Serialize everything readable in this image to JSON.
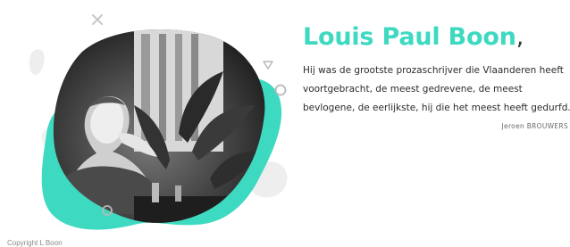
{
  "hero": {
    "title": "Louis Paul Boon",
    "title_punctuation": ",",
    "quote": "Hij was de grootste prozaschrijver die Vlaanderen heeft voortgebracht, de meest gedrevene, de meest bevlogene, de eerlijkste, hij die het meest heeft gedurfd.",
    "author": "Jeroen BROUWERS"
  },
  "portrait": {
    "description_icon": "portrait-photo"
  },
  "footer": {
    "copyright": "Copyright  L Boon"
  },
  "colors": {
    "accent": "#3dd9c1",
    "text": "#2b2b2b",
    "muted": "#888888",
    "blob_grey": "#eeeeee"
  }
}
